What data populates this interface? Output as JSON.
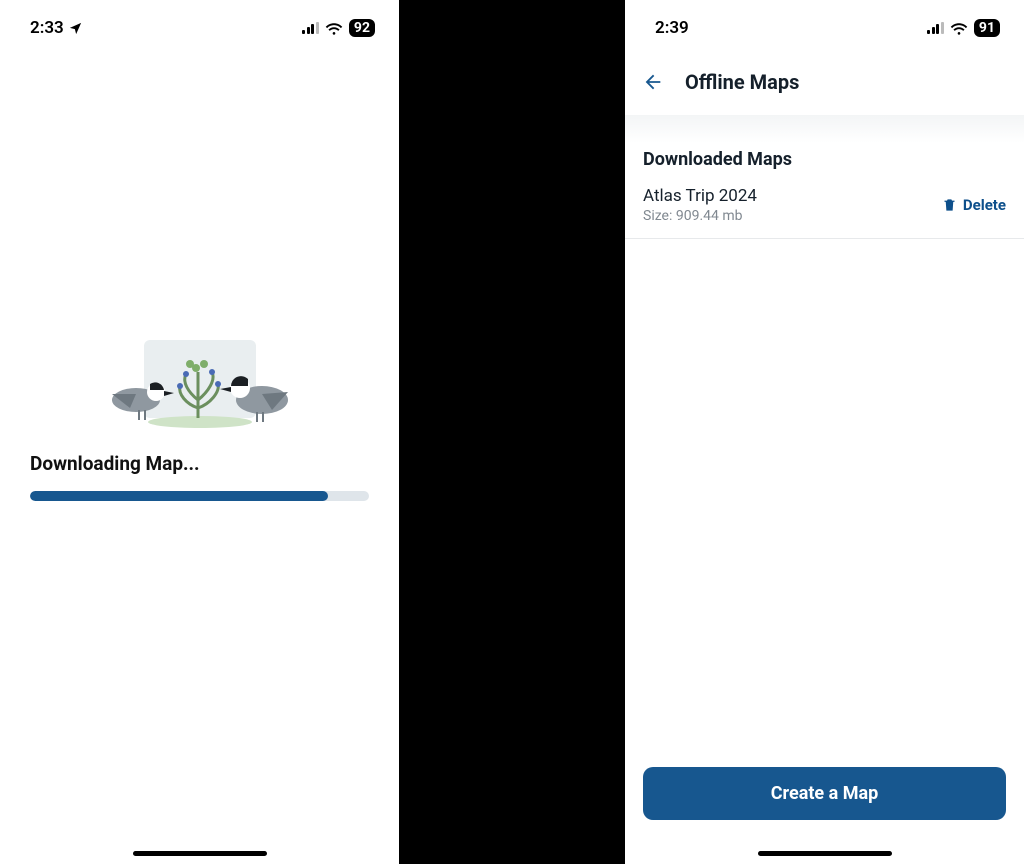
{
  "left": {
    "status": {
      "time": "2:33",
      "battery": "92"
    },
    "downloading_label": "Downloading Map...",
    "progress_pct": 88
  },
  "right": {
    "status": {
      "time": "2:39",
      "battery": "91"
    },
    "nav_title": "Offline Maps",
    "section_title": "Downloaded Maps",
    "map": {
      "name": "Atlas Trip 2024",
      "size_label": "Size: 909.44 mb",
      "delete_label": "Delete"
    },
    "create_label": "Create a Map"
  }
}
